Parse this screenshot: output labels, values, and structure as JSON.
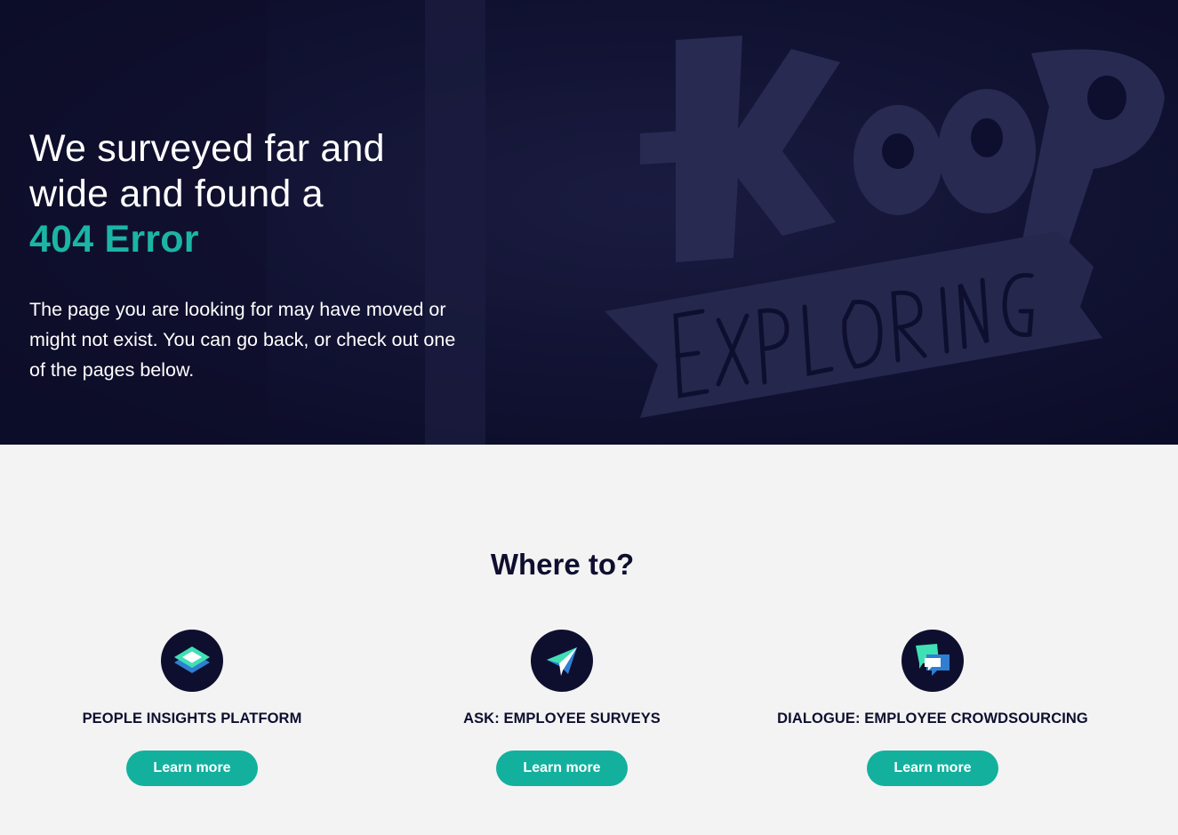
{
  "hero": {
    "headline_line1": "We surveyed far and",
    "headline_line2": "wide and found a",
    "headline_error": "404 Error",
    "description": "The page you are looking for may have moved or might not exist. You can go back, or check out one of the pages below.",
    "background_lettering": [
      "Keep",
      "EXPLORING"
    ],
    "colors": {
      "background": "#0e0f2f",
      "accent": "#1bb5a6"
    }
  },
  "section": {
    "title": "Where to?"
  },
  "cards": [
    {
      "title": "PEOPLE INSIGHTS PLATFORM",
      "button": "Learn more",
      "icon": "layers-icon"
    },
    {
      "title": "ASK: EMPLOYEE SURVEYS",
      "button": "Learn more",
      "icon": "paper-plane-icon"
    },
    {
      "title": "DIALOGUE: EMPLOYEE CROWDSOURCING",
      "button": "Learn more",
      "icon": "chat-bubbles-icon"
    }
  ],
  "colors": {
    "button": "#13b09e",
    "text_dark": "#0e0f2f",
    "light_bg": "#f3f3f3"
  }
}
